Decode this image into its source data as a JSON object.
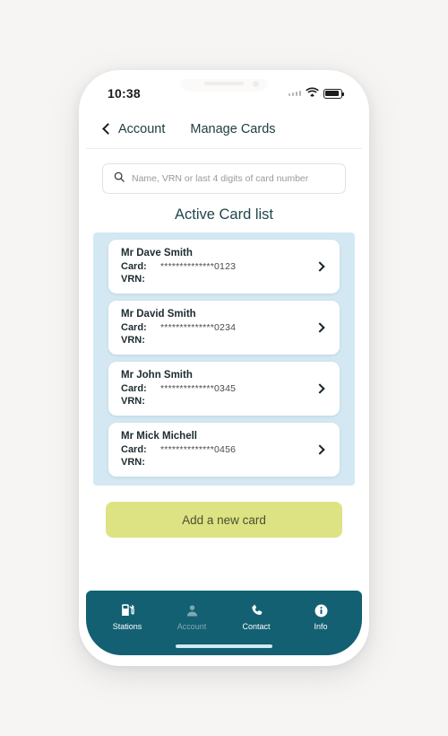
{
  "status_bar": {
    "time": "10:38",
    "signal_icon": "signal-dots-icon",
    "wifi_icon": "wifi-icon",
    "battery_icon": "battery-icon"
  },
  "header": {
    "back_label": "Account",
    "title": "Manage Cards",
    "back_icon": "chevron-left-icon"
  },
  "search": {
    "placeholder": "Name, VRN or last 4 digits of card number",
    "value": "",
    "icon": "search-icon"
  },
  "main": {
    "section_title": "Active Card list",
    "card_key_label": "Card:",
    "vrn_key_label": "VRN:",
    "chevron_icon": "chevron-right-icon",
    "cards": [
      {
        "name": "Mr Dave Smith",
        "card_masked": "**************",
        "card_last4": "0123",
        "vrn": ""
      },
      {
        "name": "Mr David Smith",
        "card_masked": "**************",
        "card_last4": "0234",
        "vrn": ""
      },
      {
        "name": "Mr John Smith",
        "card_masked": "**************",
        "card_last4": "0345",
        "vrn": ""
      },
      {
        "name": "Mr Mick Michell",
        "card_masked": "**************",
        "card_last4": "0456",
        "vrn": ""
      }
    ],
    "add_card_label": "Add a new card"
  },
  "bottom_nav": {
    "items": [
      {
        "label": "Stations",
        "icon": "fuel-pump-icon",
        "active": false
      },
      {
        "label": "Account",
        "icon": "person-icon",
        "active": true
      },
      {
        "label": "Contact",
        "icon": "phone-icon",
        "active": false
      },
      {
        "label": "Info",
        "icon": "info-icon",
        "active": false
      }
    ]
  },
  "colors": {
    "page_background": "#f6f5f4",
    "nav_teal": "#136073",
    "card_list_blue": "#d3e8f2",
    "add_button_green": "#dde383",
    "heading_text": "#23464a"
  }
}
